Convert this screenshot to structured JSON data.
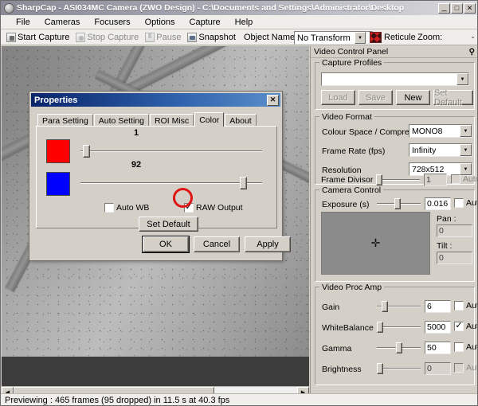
{
  "window": {
    "title": "SharpCap - ASI034MC Camera (ZWO Design) - C:\\Documents and Settings\\Administrator\\Desktop",
    "icon": "camera-icon",
    "minimize": "_",
    "maximize": "□",
    "close": "✕"
  },
  "menu": {
    "items": [
      {
        "label": "File"
      },
      {
        "label": "Cameras"
      },
      {
        "label": "Focusers"
      },
      {
        "label": "Options"
      },
      {
        "label": "Capture"
      },
      {
        "label": "Help"
      }
    ]
  },
  "toolbar": {
    "start_capture": "Start Capture",
    "stop_capture": "Stop Capture",
    "pause": "Pause",
    "snapshot": "Snapshot",
    "object_name_label": "Object Name :",
    "object_name_value": "",
    "object_name_placeholder": "",
    "transform_value": "No Transform",
    "reticule_label": "Reticule",
    "zoom_label": "Zoom:",
    "overflow": "⌄"
  },
  "statusbar": {
    "text": "Previewing : 465 frames (95 dropped) in 11.5 s at 40.3 fps"
  },
  "panel": {
    "header": "Video Control Panel",
    "pin_icon": "pin-icon",
    "capture_profiles": {
      "legend": "Capture Profiles",
      "selected": "",
      "load": "Load",
      "save": "Save",
      "new": "New",
      "set_default": "Set Default"
    },
    "video_format": {
      "legend": "Video Format",
      "colour_space_label": "Colour Space / Compression",
      "colour_space_value": "MONO8",
      "frame_rate_label": "Frame Rate (fps)",
      "frame_rate_value": "Infinity",
      "resolution_label": "Resolution",
      "resolution_value": "728x512",
      "frame_divisor_label": "Frame Divisor",
      "frame_divisor_value": "1",
      "frame_divisor_auto": "Auto"
    },
    "camera_control": {
      "legend": "Camera Control",
      "exposure_label": "Exposure (s)",
      "exposure_value": "0.016",
      "exposure_auto": "Auto",
      "pan_label": "Pan :",
      "pan_value": "0",
      "tilt_label": "Tilt :",
      "tilt_value": "0",
      "crosshair_icon": "crosshair-icon"
    },
    "video_proc_amp": {
      "legend": "Video Proc Amp",
      "rows": [
        {
          "label": "Gain",
          "value": "6",
          "auto_label": "Auto",
          "auto_checked": false,
          "auto_disabled": false,
          "slider_pct": 12
        },
        {
          "label": "WhiteBalance",
          "value": "5000",
          "auto_label": "Auto",
          "auto_checked": true,
          "auto_disabled": false,
          "slider_pct": 3
        },
        {
          "label": "Gamma",
          "value": "50",
          "auto_label": "Auto",
          "auto_checked": false,
          "auto_disabled": false,
          "slider_pct": 48
        },
        {
          "label": "Brightness",
          "value": "0",
          "auto_label": "Auto",
          "auto_checked": false,
          "auto_disabled": true,
          "slider_pct": 3
        }
      ]
    }
  },
  "dialog": {
    "title": "Properties",
    "close": "✕",
    "tabs": [
      {
        "label": "Para Setting",
        "active": false
      },
      {
        "label": "Auto Setting",
        "active": false
      },
      {
        "label": "ROI Misc",
        "active": false
      },
      {
        "label": "Color",
        "active": true
      },
      {
        "label": "About",
        "active": false
      }
    ],
    "color_tab": {
      "red_swatch": "#FF0000",
      "blue_swatch": "#0000FF",
      "red_value": "1",
      "red_slider_pct": 2,
      "blue_value": "92",
      "blue_slider_pct": 92,
      "auto_wb_label": "Auto WB",
      "auto_wb_checked": false,
      "raw_output_label": "RAW Output",
      "raw_output_checked": true,
      "set_default": "Set Default"
    },
    "buttons": {
      "ok": "OK",
      "cancel": "Cancel",
      "apply": "Apply"
    },
    "annotation": {
      "type": "red-circle-highlight",
      "color": "#E01414",
      "target": "raw-output-checkbox"
    }
  }
}
